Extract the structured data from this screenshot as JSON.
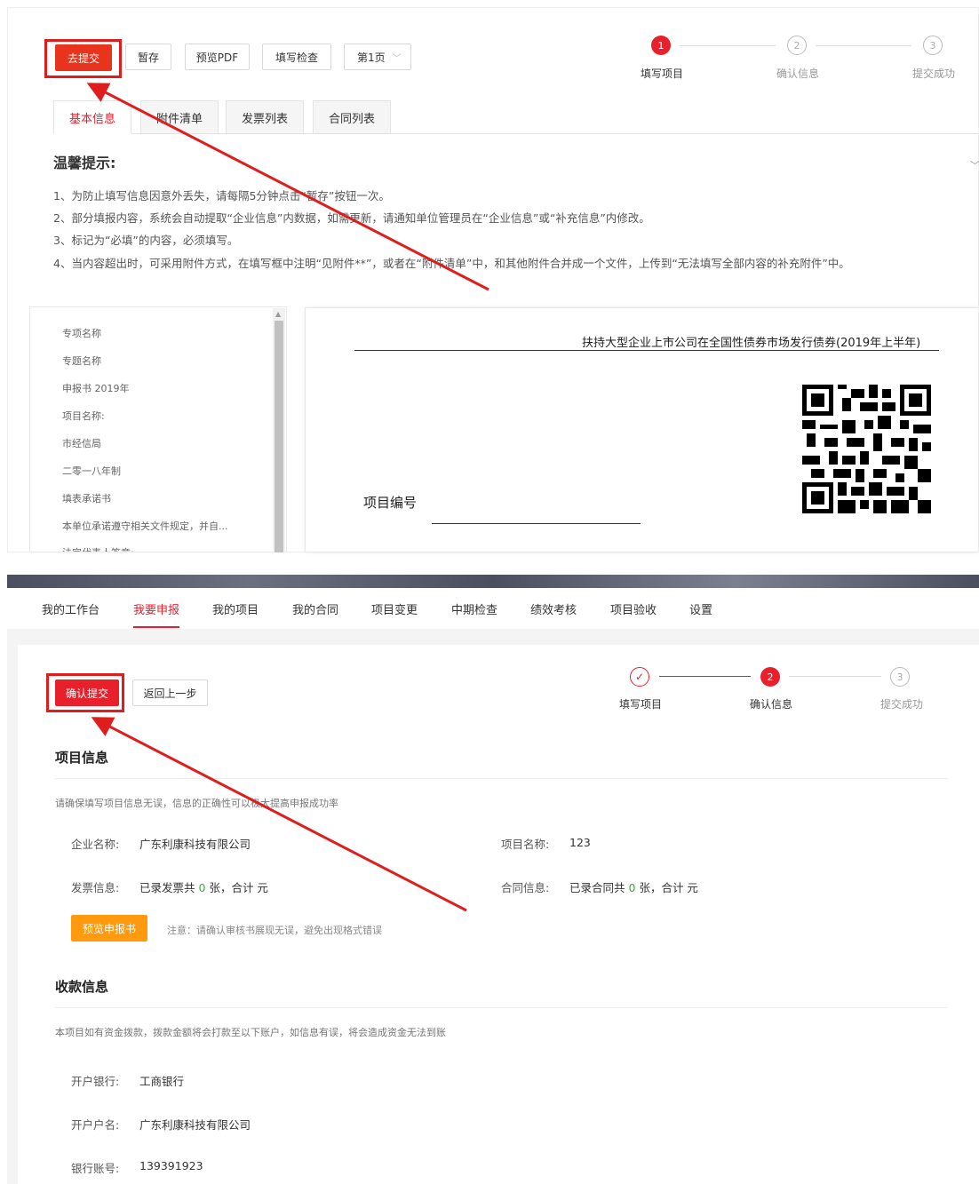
{
  "toolbar": {
    "submit_label": "去提交",
    "save_label": "暂存",
    "preview_pdf_label": "预览PDF",
    "check_label": "填写检查",
    "page_select_label": "第1页"
  },
  "steps_top": [
    {
      "number": "1",
      "label": "填写项目",
      "state": "active"
    },
    {
      "number": "2",
      "label": "确认信息",
      "state": "idle"
    },
    {
      "number": "3",
      "label": "提交成功",
      "state": "idle"
    }
  ],
  "tabs": [
    {
      "label": "基本信息",
      "active": true
    },
    {
      "label": "附件清单",
      "active": false
    },
    {
      "label": "发票列表",
      "active": false
    },
    {
      "label": "合同列表",
      "active": false
    }
  ],
  "tips": {
    "title": "温馨提示:",
    "items": [
      "1、为防止填写信息因意外丢失，请每隔5分钟点击“暂存”按钮一次。",
      "2、部分填报内容，系统会自动提取“企业信息”内数据，如需更新，请通知单位管理员在“企业信息”或“补充信息”内修改。",
      "3、标记为“必填”的内容，必须填写。",
      "4、当内容超出时，可采用附件方式，在填写框中注明“见附件**”，或者在“附件清单”中，和其他附件合并成一个文件，上传到“无法填写全部内容的补充附件”中。"
    ]
  },
  "sidebar": {
    "items": [
      "专项名称",
      "专题名称",
      "申报书 2019年",
      "项目名称:",
      "市经信局",
      "二零一八年制",
      "填表承诺书",
      "本单位承诺遵守相关文件规定，并自...",
      "法定代表人签章:"
    ]
  },
  "document": {
    "title": "扶持大型企业上市公司在全国性债券市场发行债券(2019年上半年)",
    "project_number_label": "项目编号"
  },
  "nav": {
    "items": [
      {
        "label": "我的工作台",
        "active": false
      },
      {
        "label": "我要申报",
        "active": true
      },
      {
        "label": "我的项目",
        "active": false
      },
      {
        "label": "我的合同",
        "active": false
      },
      {
        "label": "项目变更",
        "active": false
      },
      {
        "label": "中期检查",
        "active": false
      },
      {
        "label": "绩效考核",
        "active": false
      },
      {
        "label": "项目验收",
        "active": false
      },
      {
        "label": "设置",
        "active": false
      }
    ]
  },
  "confirm_toolbar": {
    "confirm_label": "确认提交",
    "back_label": "返回上一步"
  },
  "steps_bottom": [
    {
      "number": "✓",
      "label": "填写项目",
      "state": "done"
    },
    {
      "number": "2",
      "label": "确认信息",
      "state": "active"
    },
    {
      "number": "3",
      "label": "提交成功",
      "state": "idle"
    }
  ],
  "project_info": {
    "title": "项目信息",
    "note": "请确保填写项目信息无误，信息的正确性可以极大提高申报成功率",
    "company_label": "企业名称:",
    "company_value": "广东利康科技有限公司",
    "project_name_label": "项目名称:",
    "project_name_value": "123",
    "invoice_label": "发票信息:",
    "invoice_prefix": "已录发票共",
    "invoice_count": "0",
    "invoice_suffix": "张，合计 元",
    "contract_label": "合同信息:",
    "contract_prefix": "已录合同共",
    "contract_count": "0",
    "contract_suffix": "张，合计 元",
    "preview_button": "预览申报书",
    "preview_note": "注意：请确认审核书展现无误，避免出现格式错误"
  },
  "payment_info": {
    "title": "收款信息",
    "note": "本项目如有资金拨款，拨款金额将会打款至以下账户，如信息有误，将会造成资金无法到账",
    "bank_label": "开户银行:",
    "bank_value": "工商银行",
    "account_name_label": "开户户名:",
    "account_name_value": "广东利康科技有限公司",
    "account_no_label": "银行账号:",
    "account_no_value": "139391923"
  },
  "colors": {
    "primary_red": "#e8202c",
    "highlight_red": "#e01d1d",
    "orange": "#ff9a0f",
    "success_green": "#2eb82e"
  }
}
